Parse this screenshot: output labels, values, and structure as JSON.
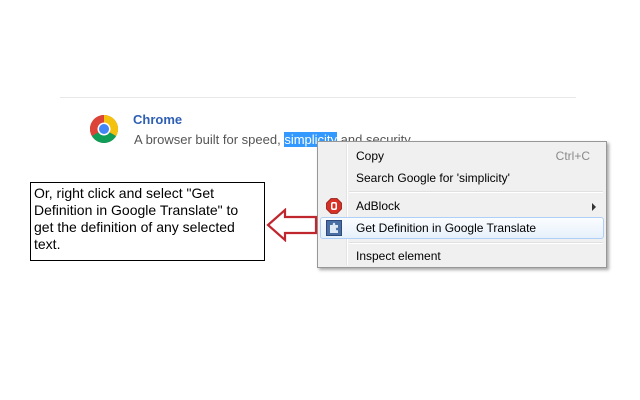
{
  "app": {
    "title": "Chrome",
    "description_before": "A browser built for speed, ",
    "description_selected": "simplicity",
    "description_after": " and security."
  },
  "context_menu": {
    "items": [
      {
        "label": "Copy",
        "shortcut": "Ctrl+C"
      },
      {
        "label": "Search Google for 'simplicity'"
      },
      {
        "label": "AdBlock",
        "icon": "adblock-stop-sign-icon",
        "submenu": true
      },
      {
        "label": "Get Definition in Google Translate",
        "icon": "puzzle-extension-icon",
        "highlighted": true
      },
      {
        "label": "Inspect element"
      }
    ]
  },
  "callout": {
    "text": "Or, right click and select \"Get Definition in Google Translate\" to get the definition of any selected text."
  },
  "colors": {
    "arrow": "#c0262e",
    "link": "#2f5fb3",
    "selection": "#3399ff"
  }
}
